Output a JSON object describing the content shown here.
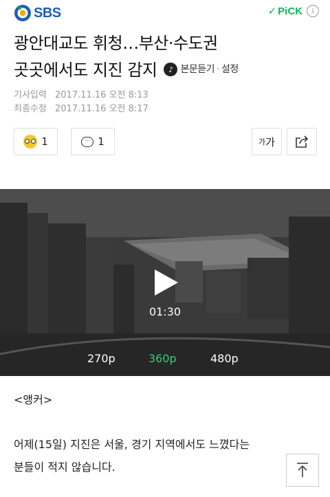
{
  "header": {
    "brand": "SBS",
    "pick_check": "✓",
    "pick_label": "PiCK",
    "info_icon": "i"
  },
  "article": {
    "title_line1": "광안대교도 휘청…부산·수도권",
    "title_line2": "곳곳에서도 지진 감지",
    "tts_label": "본문듣기",
    "tts_sep": "·",
    "settings_label": "설정",
    "published_label": "기사입력",
    "published_time": "2017.11.16 오전 8:13",
    "updated_label": "최종수정",
    "updated_time": "2017.11.16 오전 8:17"
  },
  "actions": {
    "reaction_count": "1",
    "comment_count": "1",
    "font_small": "가",
    "font_large": "가"
  },
  "video": {
    "duration": "01:30",
    "qualities": [
      "270p",
      "360p",
      "480p"
    ],
    "selected_quality": "360p"
  },
  "body": {
    "anchor_tag": "<앵커>",
    "paragraph_line1": "어제(15일) 지진은 서울, 경기 지역에서도 느꼈다는",
    "paragraph_line2": "분들이 적지 않습니다."
  },
  "colors": {
    "brand_blue": "#1d5fb3",
    "pick_green": "#11b35a",
    "quality_selected": "#2fd07a"
  }
}
